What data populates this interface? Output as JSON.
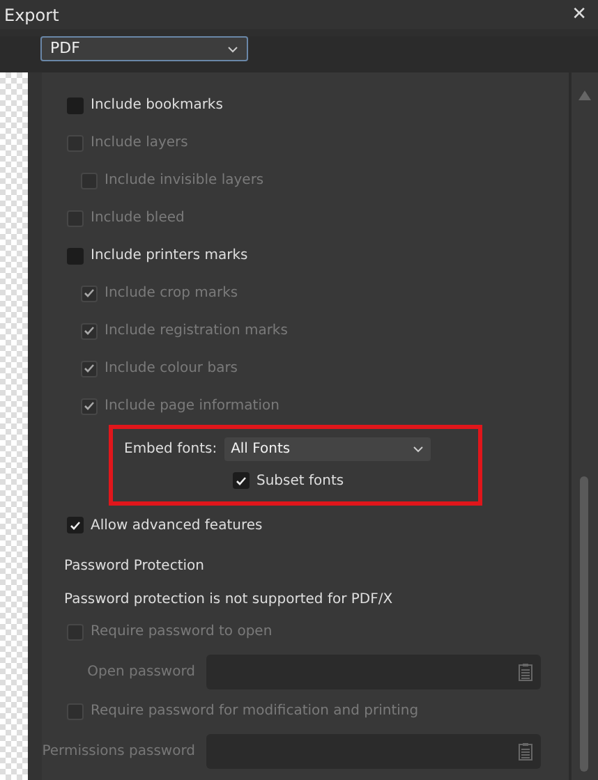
{
  "window": {
    "title": "Export",
    "close": "✕"
  },
  "format_select": {
    "value": "PDF"
  },
  "options": [
    {
      "label": "Include bookmarks",
      "checked": false,
      "disabled": false
    },
    {
      "label": "Include layers",
      "checked": false,
      "disabled": true,
      "children": [
        {
          "label": "Include invisible layers",
          "checked": false,
          "disabled": true
        }
      ]
    },
    {
      "label": "Include bleed",
      "checked": false,
      "disabled": true
    },
    {
      "label": "Include printers marks",
      "checked": false,
      "disabled": false,
      "children": [
        {
          "label": "Include crop marks",
          "checked": true,
          "disabled": true
        },
        {
          "label": "Include registration marks",
          "checked": true,
          "disabled": true
        },
        {
          "label": "Include colour bars",
          "checked": true,
          "disabled": true
        },
        {
          "label": "Include page information",
          "checked": true,
          "disabled": true
        }
      ]
    }
  ],
  "font_options": {
    "highlighted": true,
    "label": "Embed fonts:",
    "value": "All Fonts",
    "subset": {
      "label": "Subset fonts",
      "checked": true
    }
  },
  "advanced": {
    "label": "Allow advanced features",
    "checked": true
  },
  "password": {
    "heading": "Password Protection",
    "note": "Password protection is not supported for PDF/X",
    "items": [
      {
        "kind": "checkbox",
        "label": "Require password to open",
        "checked": false,
        "disabled": true
      },
      {
        "kind": "field",
        "label": "Open password"
      },
      {
        "kind": "checkbox",
        "label": "Require password for modification and printing",
        "checked": false,
        "disabled": true
      },
      {
        "kind": "field",
        "label": "Permissions password"
      }
    ]
  }
}
